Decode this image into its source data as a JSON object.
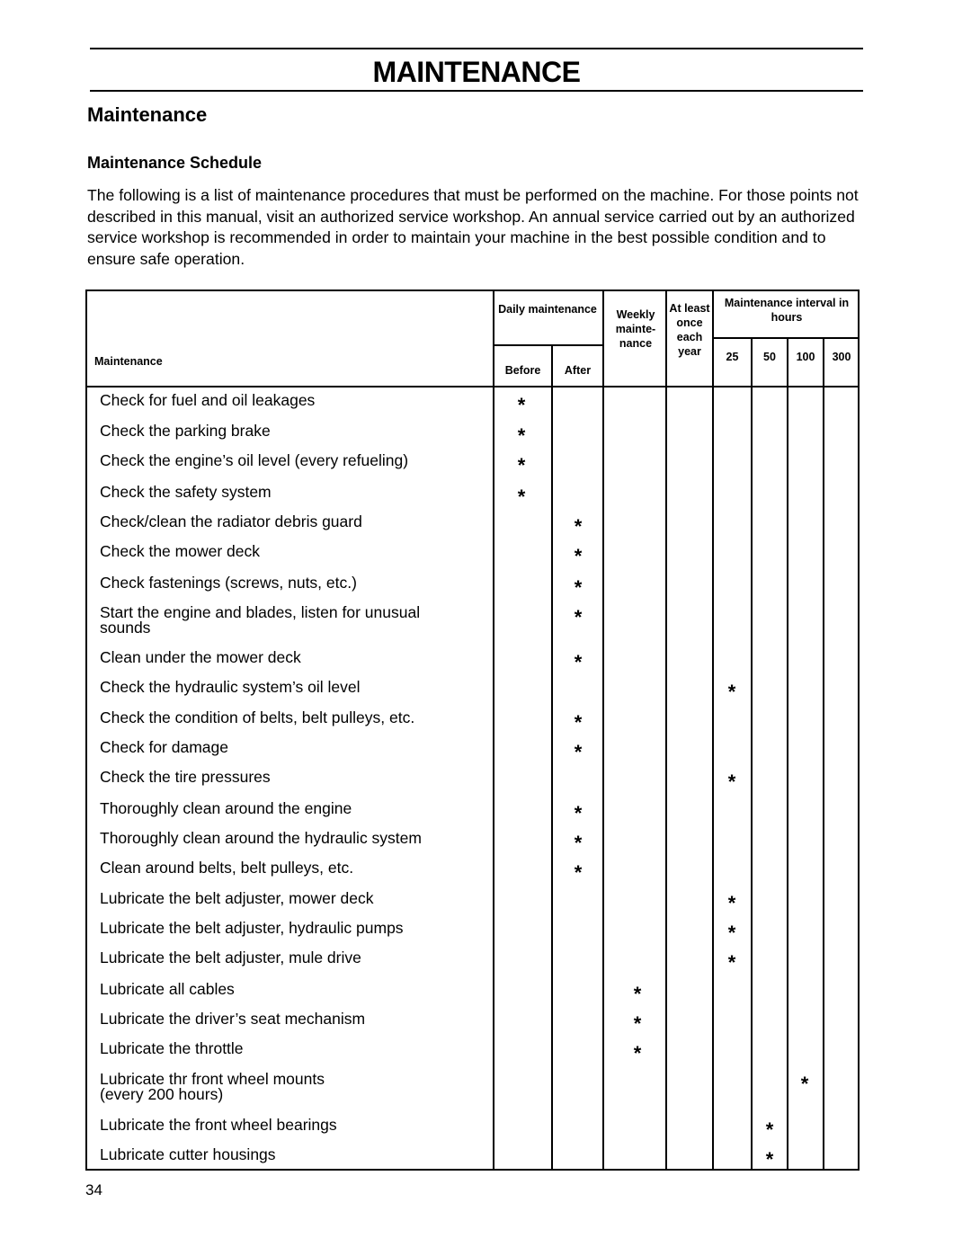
{
  "header": {
    "title": "MAINTENANCE"
  },
  "section_title": "Maintenance",
  "subsection_title": "Maintenance Schedule",
  "intro_text": "The following is a list of maintenance procedures that must be performed on the machine. For those points not described in this manual, visit an authorized service workshop. An annual service carried out by an authorized service workshop is recommended in order to maintain your machine in the best possible condition and to ensure safe operation.",
  "table": {
    "headers": {
      "maintenance": "Maintenance",
      "daily": "Daily maintenance",
      "daily_before": "Before",
      "daily_after": "After",
      "weekly": "Weekly mainte- nance",
      "yearly": "At least once each year",
      "interval": "Maintenance interval in hours",
      "h25": "25",
      "h50": "50",
      "h100": "100",
      "h300": "300"
    },
    "mark_symbol": "*",
    "columns": [
      "before",
      "after",
      "weekly",
      "yearly",
      "h25",
      "h50",
      "h100",
      "h300"
    ],
    "rows": [
      {
        "task": "Check for fuel and oil leakages",
        "marks": [
          "before"
        ]
      },
      {
        "task": "Check the parking brake",
        "marks": [
          "before"
        ]
      },
      {
        "task": "Check the engine’s oil level (every refueling)",
        "marks": [
          "before"
        ]
      },
      {
        "task": "Check the safety system",
        "marks": [
          "before"
        ]
      },
      {
        "task": "Check/clean the radiator debris guard",
        "marks": [
          "after"
        ]
      },
      {
        "task": "Check the mower deck",
        "marks": [
          "after"
        ]
      },
      {
        "task": "Check fastenings (screws, nuts, etc.)",
        "marks": [
          "after"
        ]
      },
      {
        "task": "Start the engine and blades, listen for unusual",
        "task_line2": "sounds",
        "marks": [
          "after"
        ]
      },
      {
        "task": "Clean under the mower deck",
        "marks": [
          "after"
        ]
      },
      {
        "task": "Check the hydraulic system’s oil level",
        "marks": [
          "h25"
        ]
      },
      {
        "task": "Check the condition of belts, belt pulleys, etc.",
        "marks": [
          "after"
        ]
      },
      {
        "task": "Check for damage",
        "marks": [
          "after"
        ]
      },
      {
        "task": "Check the tire pressures",
        "marks": [
          "h25"
        ]
      },
      {
        "task": "Thoroughly clean around the engine",
        "marks": [
          "after"
        ]
      },
      {
        "task": "Thoroughly clean around the hydraulic system",
        "marks": [
          "after"
        ]
      },
      {
        "task": "Clean around belts, belt pulleys, etc.",
        "marks": [
          "after"
        ]
      },
      {
        "task": "Lubricate the belt adjuster, mower deck",
        "marks": [
          "h25"
        ]
      },
      {
        "task": "Lubricate the belt adjuster, hydraulic pumps",
        "marks": [
          "h25"
        ]
      },
      {
        "task": "Lubricate the belt adjuster, mule drive",
        "marks": [
          "h25"
        ]
      },
      {
        "task": "Lubricate all cables",
        "marks": [
          "weekly"
        ]
      },
      {
        "task": "Lubricate the driver’s seat mechanism",
        "marks": [
          "weekly"
        ]
      },
      {
        "task": "Lubricate the throttle",
        "marks": [
          "weekly"
        ]
      },
      {
        "task": "Lubricate thr front wheel mounts",
        "task_line2": "(every 200 hours)",
        "marks": [
          "h100"
        ]
      },
      {
        "task": "Lubricate the front wheel bearings",
        "marks": [
          "h50"
        ]
      },
      {
        "task": "Lubricate cutter housings",
        "marks": [
          "h50"
        ]
      }
    ]
  },
  "footer": {
    "page_number": "34"
  }
}
